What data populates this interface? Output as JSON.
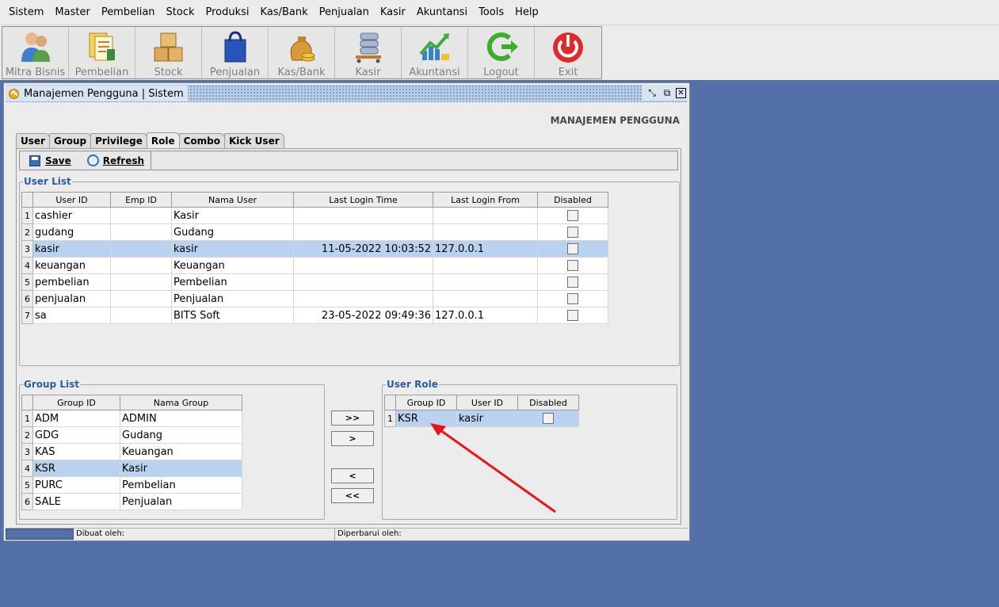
{
  "menu": [
    "Sistem",
    "Master",
    "Pembelian",
    "Stock",
    "Produksi",
    "Kas/Bank",
    "Penjualan",
    "Kasir",
    "Akuntansi",
    "Tools",
    "Help"
  ],
  "toolbar": [
    "Mitra Bisnis",
    "Pembelian",
    "Stock",
    "Penjualan",
    "Kas/Bank",
    "Kasir",
    "Akuntansi",
    "Logout",
    "Exit"
  ],
  "window": {
    "title": "Manajemen Pengguna | Sistem",
    "header": "MANAJEMEN PENGGUNA"
  },
  "tabs": [
    "User",
    "Group",
    "Privilege",
    "Role",
    "Combo",
    "Kick User"
  ],
  "actions": {
    "save": "Save",
    "refresh": "Refresh"
  },
  "user_list": {
    "legend": "User List",
    "columns": [
      "User ID",
      "Emp ID",
      "Nama User",
      "Last Login Time",
      "Last Login From",
      "Disabled"
    ],
    "rows": [
      {
        "n": "1",
        "id": "cashier",
        "emp": "",
        "nama": "Kasir",
        "time": "",
        "from": ""
      },
      {
        "n": "2",
        "id": "gudang",
        "emp": "",
        "nama": "Gudang",
        "time": "",
        "from": ""
      },
      {
        "n": "3",
        "id": "kasir",
        "emp": "",
        "nama": "kasir",
        "time": "11-05-2022 10:03:52",
        "from": "127.0.0.1"
      },
      {
        "n": "4",
        "id": "keuangan",
        "emp": "",
        "nama": "Keuangan",
        "time": "",
        "from": ""
      },
      {
        "n": "5",
        "id": "pembelian",
        "emp": "",
        "nama": "Pembelian",
        "time": "",
        "from": ""
      },
      {
        "n": "6",
        "id": "penjualan",
        "emp": "",
        "nama": "Penjualan",
        "time": "",
        "from": ""
      },
      {
        "n": "7",
        "id": "sa",
        "emp": "",
        "nama": "BITS Soft",
        "time": "23-05-2022 09:49:36",
        "from": "127.0.0.1"
      }
    ]
  },
  "group_list": {
    "legend": "Group List",
    "columns": [
      "Group ID",
      "Nama Group"
    ],
    "rows": [
      {
        "n": "1",
        "id": "ADM",
        "nama": "ADMIN"
      },
      {
        "n": "2",
        "id": "GDG",
        "nama": "Gudang"
      },
      {
        "n": "3",
        "id": "KAS",
        "nama": "Keuangan"
      },
      {
        "n": "4",
        "id": "KSR",
        "nama": "Kasir"
      },
      {
        "n": "5",
        "id": "PURC",
        "nama": "Pembelian"
      },
      {
        "n": "6",
        "id": "SALE",
        "nama": "Penjualan"
      }
    ]
  },
  "transfer": {
    "add_all": ">>",
    "add": ">",
    "remove": "<",
    "remove_all": "<<"
  },
  "user_role": {
    "legend": "User Role",
    "columns": [
      "Group ID",
      "User ID",
      "Disabled"
    ],
    "rows": [
      {
        "n": "1",
        "group": "KSR",
        "user": "kasir"
      }
    ]
  },
  "status": {
    "created": "Dibuat oleh:",
    "updated": "Diperbarui oleh:"
  },
  "colors": {
    "desktop": "#5470a8",
    "selection": "#b8d2f0",
    "arrow": "#e8141a"
  }
}
